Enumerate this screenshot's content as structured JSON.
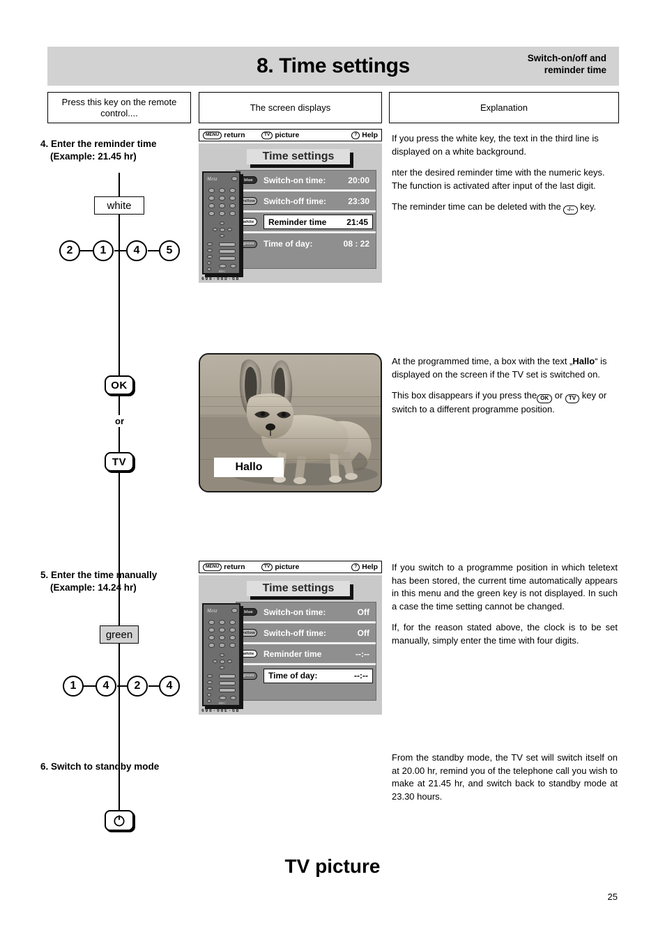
{
  "header": {
    "title": "8. Time settings",
    "subtitle_line1": "Switch-on/off and",
    "subtitle_line2": "reminder time"
  },
  "column_headers": {
    "col1": "Press this key on the remote control....",
    "col2": "The screen displays",
    "col3": "Explanation"
  },
  "steps": [
    {
      "number_title": "4. Enter the reminder time",
      "example": "(Example: 21.45 hr)",
      "key_label": "white",
      "digits": [
        "2",
        "1",
        "4",
        "5"
      ]
    },
    {
      "number_title": "5. Enter the time manually",
      "example": "(Example: 14.24 hr)",
      "key_label": "green",
      "digits": [
        "1",
        "4",
        "2",
        "4"
      ]
    },
    {
      "number_title": "6. Switch to standby mode",
      "key_icon": "power-standby-icon"
    }
  ],
  "remote_keys": {
    "ok": "OK",
    "or": "or",
    "tv": "TV"
  },
  "osd_screen_1": {
    "topbar": {
      "menu_pill": "MENU",
      "menu_label": "return",
      "tv_pill": "TV",
      "tv_label": "picture",
      "help_pill": "?",
      "help_label": "Help"
    },
    "title": "Time settings",
    "rows": [
      {
        "badge": "blue",
        "label": "Switch-on time:",
        "value": "20:00",
        "selected": false
      },
      {
        "badge": "yellow",
        "label": "Switch-off time:",
        "value": "23:30",
        "selected": false
      },
      {
        "badge": "white",
        "label": "Reminder time",
        "value": "21:45",
        "selected": true
      },
      {
        "badge": "green",
        "label": "Time of day:",
        "value": "08 : 22",
        "selected": false
      }
    ],
    "code": "698-08D-GB"
  },
  "osd_screen_2": {
    "topbar": {
      "menu_pill": "MENU",
      "menu_label": "return",
      "tv_pill": "TV",
      "tv_label": "picture",
      "help_pill": "?",
      "help_label": "Help"
    },
    "title": "Time settings",
    "rows": [
      {
        "badge": "blue",
        "label": "Switch-on time:",
        "value": "Off",
        "selected": false
      },
      {
        "badge": "yellow",
        "label": "Switch-off time:",
        "value": "Off",
        "selected": false
      },
      {
        "badge": "white",
        "label": "Reminder time",
        "value": "--:--",
        "selected": false
      },
      {
        "badge": "green",
        "label": "Time of day:",
        "value": "--:--",
        "selected": true
      }
    ],
    "code": "698-08E-GB"
  },
  "photo_screen": {
    "overlay_text": "Hallo",
    "description": "fennec-fox-photo"
  },
  "explanations": {
    "step4": {
      "p1": "If you press the white key, the text in the third line is displayed on a white background.",
      "p2": "nter the desired reminder time with the numeric keys. The function is activated after input of the last digit.",
      "p3_before": "The reminder time can be deleted with the",
      "p3_pill": "-/--",
      "p3_after": "key."
    },
    "photo": {
      "p1_before": "At the programmed time, a box with the text „",
      "p1_bold": "Hallo",
      "p1_after": "“ is displayed on the screen if the TV set is switched on.",
      "p2_before": "This box disappears if you press the",
      "p2_pill1": "OK",
      "p2_mid": "or",
      "p2_pill2": "TV",
      "p2_after": "key  or switch to a different programme position."
    },
    "step5": {
      "p1": "If you switch to a programme position in which teletext has been stored, the current time automatically appears in this menu and the green key is not displayed. In such a case the time setting cannot be changed.",
      "p2": "If, for the reason stated above, the clock is to be set manually, simply enter the time with four digits."
    },
    "step6": {
      "p1": "From the standby mode, the TV set will switch itself on at 20.00 hr, remind you of the telephone call you wish to make at 21.45 hr, and switch back to standby mode at 23.30 hours."
    }
  },
  "footer": {
    "title": "TV picture",
    "page_number": "25"
  }
}
